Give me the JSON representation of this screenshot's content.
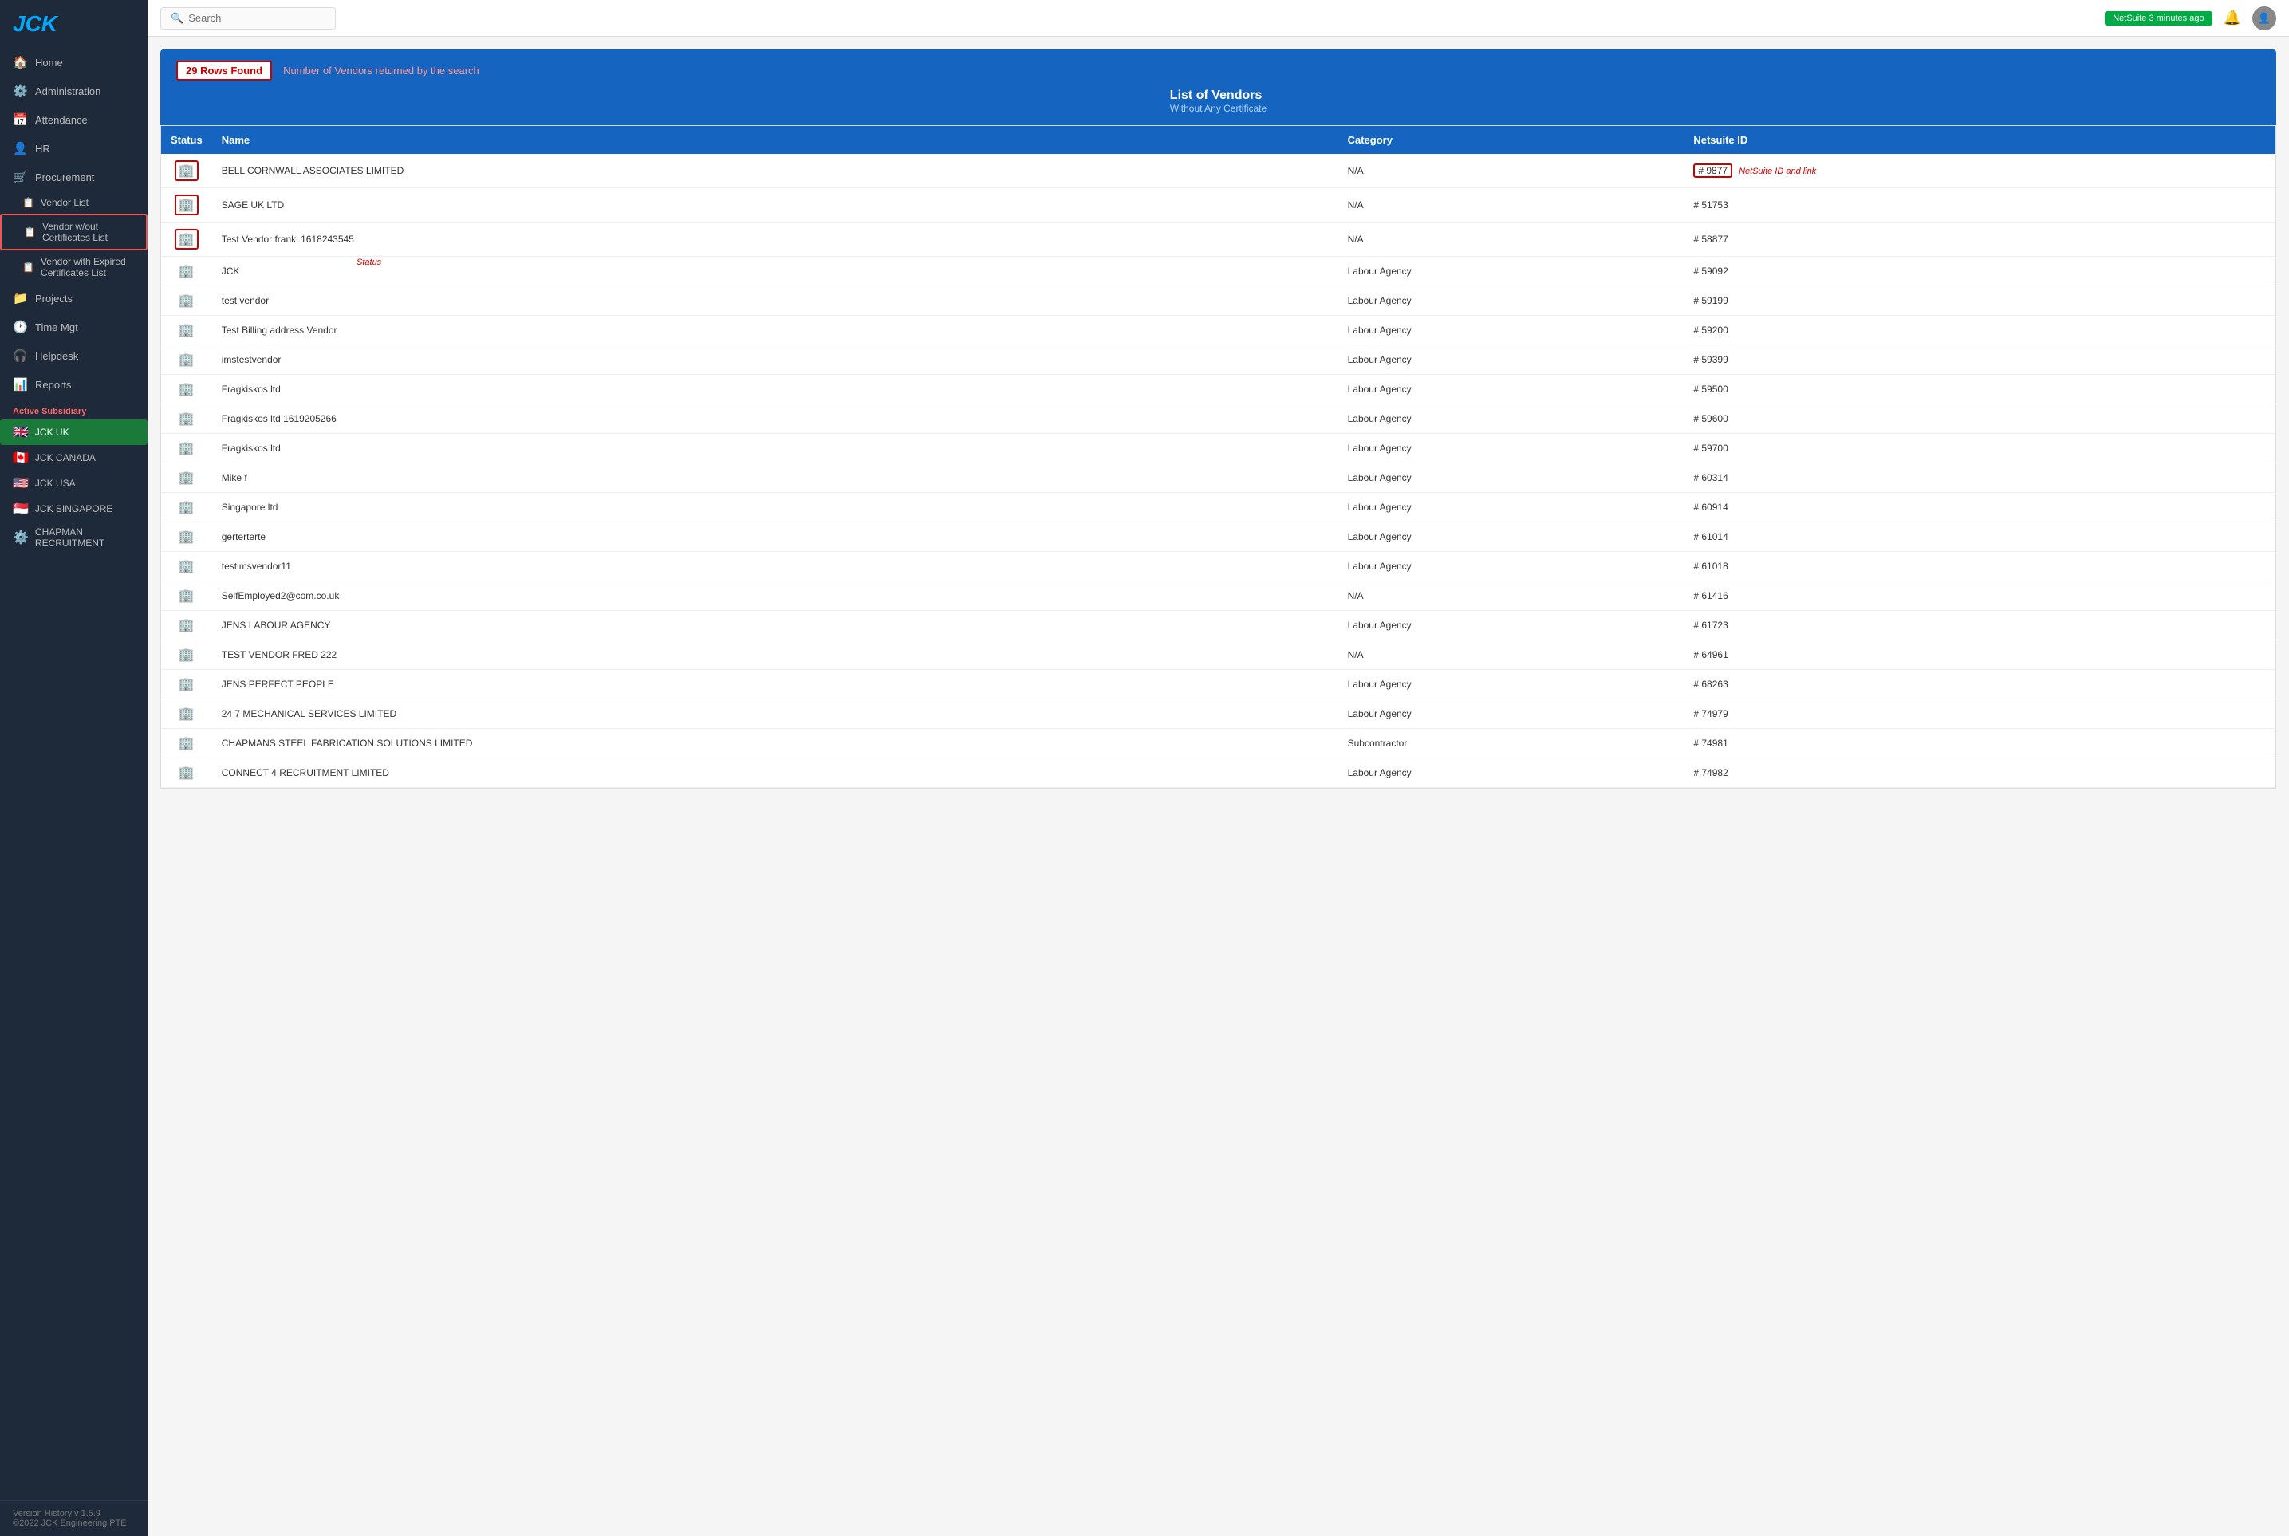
{
  "app": {
    "logo": "JCK",
    "version": "Version History v 1.5.9",
    "copyright": "©2022 JCK Engineering PTE"
  },
  "header": {
    "search_placeholder": "Search",
    "netsuite_badge": "NetSuite 3 minutes ago"
  },
  "sidebar": {
    "nav_items": [
      {
        "id": "home",
        "label": "Home",
        "icon": "🏠"
      },
      {
        "id": "administration",
        "label": "Administration",
        "icon": "⚙️"
      },
      {
        "id": "attendance",
        "label": "Attendance",
        "icon": "📅"
      },
      {
        "id": "hr",
        "label": "HR",
        "icon": "👤"
      },
      {
        "id": "procurement",
        "label": "Procurement",
        "icon": "🛒"
      },
      {
        "id": "vendor-list",
        "label": "Vendor List",
        "icon": "📋"
      },
      {
        "id": "vendor-without",
        "label": "Vendor w/out Certificates List",
        "icon": "📋"
      },
      {
        "id": "vendor-expired",
        "label": "Vendor with Expired Certificates List",
        "icon": "📋"
      },
      {
        "id": "projects",
        "label": "Projects",
        "icon": "📁"
      },
      {
        "id": "time-mgt",
        "label": "Time Mgt",
        "icon": "🕐"
      },
      {
        "id": "helpdesk",
        "label": "Helpdesk",
        "icon": "🎧"
      },
      {
        "id": "reports",
        "label": "Reports",
        "icon": "📊"
      }
    ],
    "active_subsidiary_label": "Active Subsidiary",
    "subsidiaries": [
      {
        "id": "jck-uk",
        "label": "JCK UK",
        "flag": "🇬🇧",
        "active": true
      },
      {
        "id": "jck-canada",
        "label": "JCK CANADA",
        "flag": "🇨🇦"
      },
      {
        "id": "jck-usa",
        "label": "JCK USA",
        "flag": "🇺🇸"
      },
      {
        "id": "jck-singapore",
        "label": "JCK SINGAPORE",
        "flag": "🇸🇬"
      },
      {
        "id": "chapman",
        "label": "CHAPMAN RECRUITMENT",
        "flag": "⚙️"
      }
    ]
  },
  "banner": {
    "rows_found": "29 Rows Found",
    "description": "Number of Vendors returned by the search",
    "title": "List of Vendors",
    "subtitle": "Without Any Certificate"
  },
  "table": {
    "columns": [
      "Status",
      "Name",
      "Category",
      "Netsuite ID"
    ],
    "rows": [
      {
        "name": "BELL CORNWALL ASSOCIATES LIMITED",
        "category": "N/A",
        "netsuite_id": "# 9877",
        "annotated": true
      },
      {
        "name": "SAGE UK LTD",
        "category": "N/A",
        "netsuite_id": "# 51753",
        "annotated": true
      },
      {
        "name": "Test Vendor franki 1618243545",
        "category": "N/A",
        "netsuite_id": "# 58877",
        "annotated": true
      },
      {
        "name": "JCK",
        "category": "Labour Agency",
        "netsuite_id": "# 59092"
      },
      {
        "name": "test vendor",
        "category": "Labour Agency",
        "netsuite_id": "# 59199"
      },
      {
        "name": "Test Billing address Vendor",
        "category": "Labour Agency",
        "netsuite_id": "# 59200"
      },
      {
        "name": "imstestvendor",
        "category": "Labour Agency",
        "netsuite_id": "# 59399"
      },
      {
        "name": "Fragkiskos ltd",
        "category": "Labour Agency",
        "netsuite_id": "# 59500"
      },
      {
        "name": "Fragkiskos ltd 1619205266",
        "category": "Labour Agency",
        "netsuite_id": "# 59600"
      },
      {
        "name": "Fragkiskos ltd",
        "category": "Labour Agency",
        "netsuite_id": "# 59700"
      },
      {
        "name": "Mike f",
        "category": "Labour Agency",
        "netsuite_id": "# 60314"
      },
      {
        "name": "Singapore ltd",
        "category": "Labour Agency",
        "netsuite_id": "# 60914"
      },
      {
        "name": "gerterterte",
        "category": "Labour Agency",
        "netsuite_id": "# 61014"
      },
      {
        "name": "testimsvendor11",
        "category": "Labour Agency",
        "netsuite_id": "# 61018"
      },
      {
        "name": "SelfEmployed2@com.co.uk",
        "category": "N/A",
        "netsuite_id": "# 61416"
      },
      {
        "name": "JENS LABOUR AGENCY",
        "category": "Labour Agency",
        "netsuite_id": "# 61723"
      },
      {
        "name": "TEST VENDOR FRED 222",
        "category": "N/A",
        "netsuite_id": "# 64961"
      },
      {
        "name": "JENS PERFECT PEOPLE",
        "category": "Labour Agency",
        "netsuite_id": "# 68263"
      },
      {
        "name": "24 7 MECHANICAL SERVICES LIMITED",
        "category": "Labour Agency",
        "netsuite_id": "# 74979"
      },
      {
        "name": "CHAPMANS STEEL FABRICATION SOLUTIONS LIMITED",
        "category": "Subcontractor",
        "netsuite_id": "# 74981"
      },
      {
        "name": "CONNECT 4 RECRUITMENT LIMITED",
        "category": "Labour Agency",
        "netsuite_id": "# 74982"
      }
    ],
    "netsuite_annotation": "NetSuite ID and link",
    "status_annotation": "Status"
  }
}
